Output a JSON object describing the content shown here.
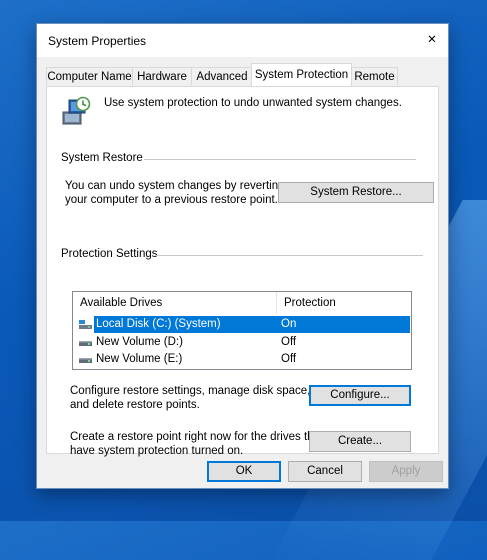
{
  "window": {
    "title": "System Properties",
    "close_glyph": "✕"
  },
  "tabs": [
    {
      "label": "Computer Name"
    },
    {
      "label": "Hardware"
    },
    {
      "label": "Advanced"
    },
    {
      "label": "System Protection",
      "active": true
    },
    {
      "label": "Remote"
    }
  ],
  "intro": {
    "icon": "system-protection-icon",
    "text": "Use system protection to undo unwanted system changes."
  },
  "system_restore": {
    "heading": "System Restore",
    "description_line1": "You can undo system changes by reverting",
    "description_line2": "your computer to a previous restore point.",
    "button_label": "System Restore..."
  },
  "protection": {
    "heading": "Protection Settings",
    "columns": {
      "drive": "Available Drives",
      "protection": "Protection"
    },
    "drives": [
      {
        "name": "Local Disk (C:) (System)",
        "protection": "On",
        "icon": "system-drive-icon",
        "selected": true
      },
      {
        "name": "New Volume (D:)",
        "protection": "Off",
        "icon": "drive-icon"
      },
      {
        "name": "New Volume (E:)",
        "protection": "Off",
        "icon": "drive-icon"
      }
    ],
    "configure_line1": "Configure restore settings, manage disk space,",
    "configure_line2": "and delete restore points.",
    "configure_button": "Configure...",
    "create_line1": "Create a restore point right now for the drives that",
    "create_line2": "have system protection turned on.",
    "create_button": "Create..."
  },
  "footer": {
    "ok": "OK",
    "cancel": "Cancel",
    "apply": "Apply"
  },
  "colors": {
    "selection": "#0078d7",
    "desktop": "#0a59b8"
  }
}
